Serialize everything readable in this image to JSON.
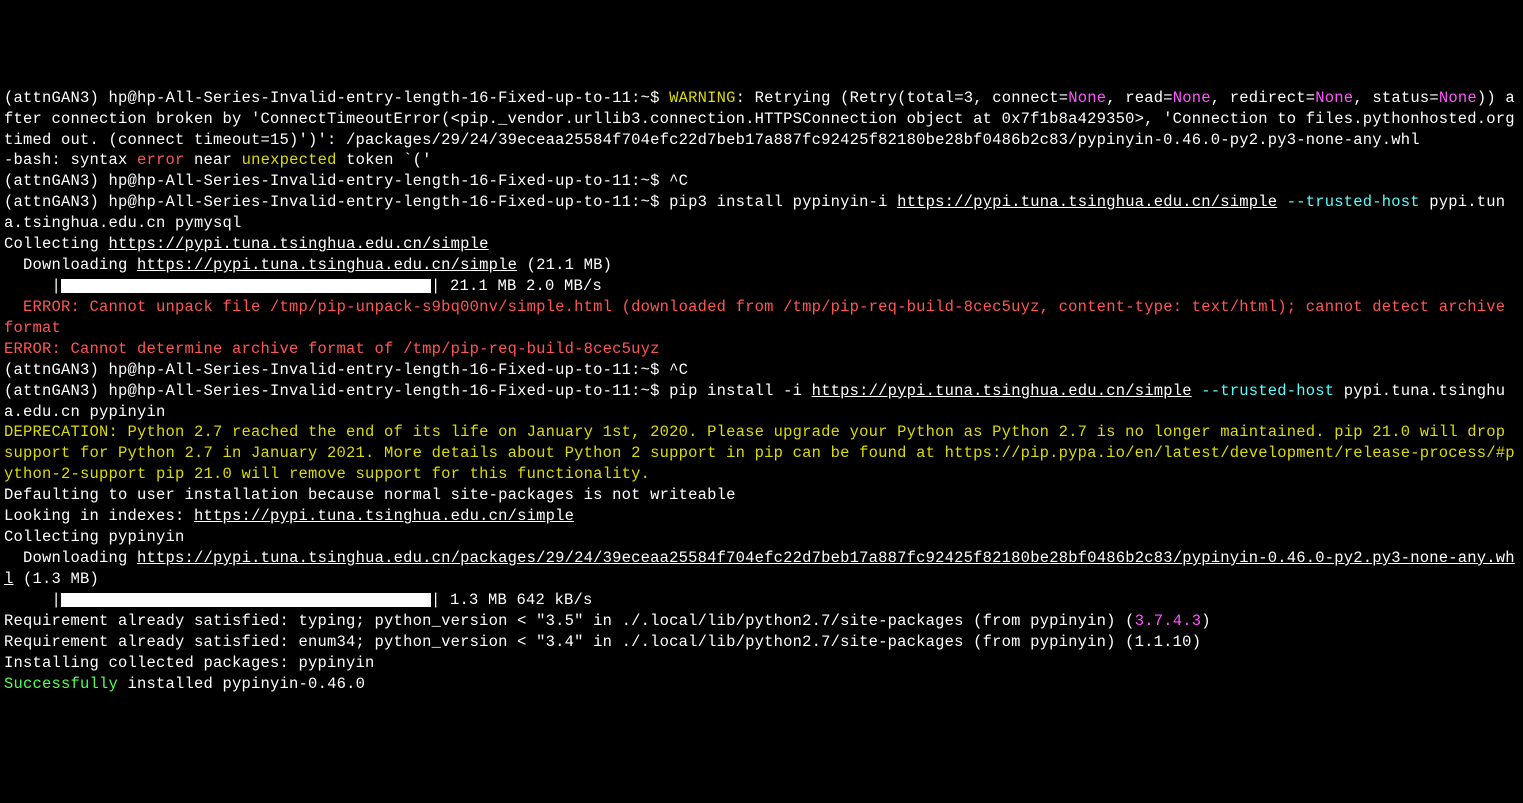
{
  "prompt_env": "(attnGAN3)",
  "prompt_user": "hp@hp-All-Series-Invalid-entry-length-16-Fixed-up-to-11:~$",
  "warning_label": "WARNING",
  "none_label": "None",
  "retry_part1": ": Retrying (Retry(total=3, connect=",
  "retry_part2": ", read=",
  "retry_part3": ", redirect=",
  "retry_part4": ", status=",
  "retry_part5": ")) after connection broken by 'ConnectTimeoutError(<pip._vendor.urllib3.connection.HTTPSConnection object at 0x7f1b8a429350>, 'Connection to files.pythonhosted.org timed out. (connect timeout=15)')': /packages/29/24/39eceaa25584f704efc22d7beb17a887fc92425f82180be28bf0486b2c83/pypinyin-0.46.0-py2.py3-none-any.whl",
  "bash_prefix": "-bash: syntax ",
  "bash_error": "error",
  "bash_mid": " near ",
  "bash_unexpected": "unexpected",
  "bash_suffix": " token `('",
  "ctrlc": " ^C",
  "cmd1_prefix": " pip3 install pypinyin-i ",
  "cmd1_url": "https://pypi.tuna.tsinghua.edu.cn/simple",
  "cmd1_flag": " --trusted-host",
  "cmd1_rest": " pypi.tuna.tsinghua.edu.cn pymysql",
  "collecting1_prefix": "Collecting ",
  "collecting1_url": "https://pypi.tuna.tsinghua.edu.cn/simple",
  "downloading1_prefix": "  Downloading ",
  "downloading1_url": "https://pypi.tuna.tsinghua.edu.cn/simple",
  "downloading1_size": " (21.1 MB)",
  "progress1_prefix": "     |",
  "progress1_suffix": "| 21.1 MB 2.0 MB/s",
  "error1": "  ERROR: Cannot unpack file /tmp/pip-unpack-s9bq00nv/simple.html (downloaded from /tmp/pip-req-build-8cec5uyz, content-type: text/html); cannot detect archive format",
  "error2": "ERROR: Cannot determine archive format of /tmp/pip-req-build-8cec5uyz",
  "cmd2_prefix": " pip install -i ",
  "cmd2_url": "https://pypi.tuna.tsinghua.edu.cn/simple",
  "cmd2_flag": " --trusted-host",
  "cmd2_rest": " pypi.tuna.tsinghua.edu.cn pypinyin",
  "deprecation": "DEPRECATION: Python 2.7 reached the end of its life on January 1st, 2020. Please upgrade your Python as Python 2.7 is no longer maintained. pip 21.0 will drop support for Python 2.7 in January 2021. More details about Python 2 support in pip can be found at https://pip.pypa.io/en/latest/development/release-process/#python-2-support pip 21.0 will remove support for this functionality.",
  "defaulting": "Defaulting to user installation because normal site-packages is not writeable",
  "looking_prefix": "Looking in indexes: ",
  "looking_url": "https://pypi.tuna.tsinghua.edu.cn/simple",
  "collecting2": "Collecting pypinyin",
  "downloading2_prefix": "  Downloading ",
  "downloading2_url": "https://pypi.tuna.tsinghua.edu.cn/packages/29/24/39eceaa25584f704efc22d7beb17a887fc92425f82180be28bf0486b2c83/pypinyin-0.46.0-py2.py3-none-any.whl",
  "downloading2_size": " (1.3 MB)",
  "progress2_prefix": "     |",
  "progress2_suffix": "| 1.3 MB 642 kB/s",
  "req1_prefix": "Requirement already satisfied: typing; python_version < \"3.5\" in ./.local/lib/python2.7/site-packages (from pypinyin) (",
  "req1_version": "3.7.4.3",
  "req1_suffix": ")",
  "req2": "Requirement already satisfied: enum34; python_version < \"3.4\" in ./.local/lib/python2.7/site-packages (from pypinyin) (1.1.10)",
  "installing": "Installing collected packages: pypinyin",
  "success_prefix": "Successfully",
  "success_rest": " installed pypinyin-0.46.0"
}
